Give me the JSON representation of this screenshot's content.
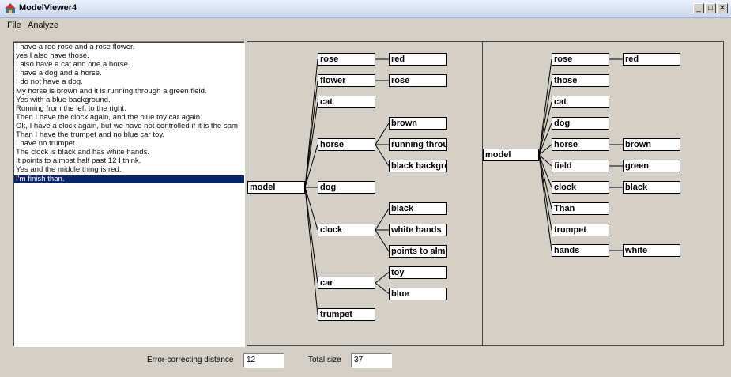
{
  "window": {
    "title": "ModelViewer4",
    "min_glyph": "_",
    "max_glyph": "□",
    "close_glyph": "✕"
  },
  "menu": {
    "file": "File",
    "analyze": "Analyze"
  },
  "conversation": {
    "lines": [
      "I have a red rose and a rose flower.",
      "yes I also have those.",
      "I also have a cat and one a horse.",
      "I have a dog and a horse.",
      "I do not have a dog.",
      "My horse is brown and it is running through a green field.",
      "Yes with a blue background.",
      "Running from the left to the right.",
      "Then I have the clock again, and the blue toy car again.",
      "Ok, I have a clock again, but  we have not controlled if it is the sam",
      "Than I have the trumpet and no blue car toy.",
      "I have no trumpet.",
      "The clock is black and has white hands.",
      "It points to almost half past 12 I think.",
      "Yes and the middle thing is red.",
      "I'm finish than."
    ],
    "selected_index": 15
  },
  "tree_left": {
    "root": "model",
    "children": [
      {
        "label": "rose",
        "children": [
          "red"
        ]
      },
      {
        "label": "flower",
        "children": [
          "rose"
        ]
      },
      {
        "label": "cat",
        "children": []
      },
      {
        "label": "horse",
        "children": [
          "brown",
          "running through a gr",
          "black background"
        ]
      },
      {
        "label": "dog",
        "children": []
      },
      {
        "label": "clock",
        "children": [
          "black",
          "white hands",
          "points to almost hal"
        ]
      },
      {
        "label": "car",
        "children": [
          "toy",
          "blue"
        ]
      },
      {
        "label": "trumpet",
        "children": []
      }
    ]
  },
  "tree_right": {
    "root": "model",
    "children": [
      {
        "label": "rose",
        "children": [
          "red"
        ]
      },
      {
        "label": "those",
        "children": []
      },
      {
        "label": "cat",
        "children": []
      },
      {
        "label": "dog",
        "children": []
      },
      {
        "label": "horse",
        "children": [
          "brown"
        ]
      },
      {
        "label": "field",
        "children": [
          "green"
        ]
      },
      {
        "label": "clock",
        "children": [
          "black"
        ]
      },
      {
        "label": "Than",
        "children": []
      },
      {
        "label": "trumpet",
        "children": []
      },
      {
        "label": "hands",
        "children": [
          "white"
        ]
      }
    ]
  },
  "status": {
    "error_label": "Error-correcting distance",
    "error_value": "12",
    "total_label": "Total size",
    "total_value": "37"
  }
}
